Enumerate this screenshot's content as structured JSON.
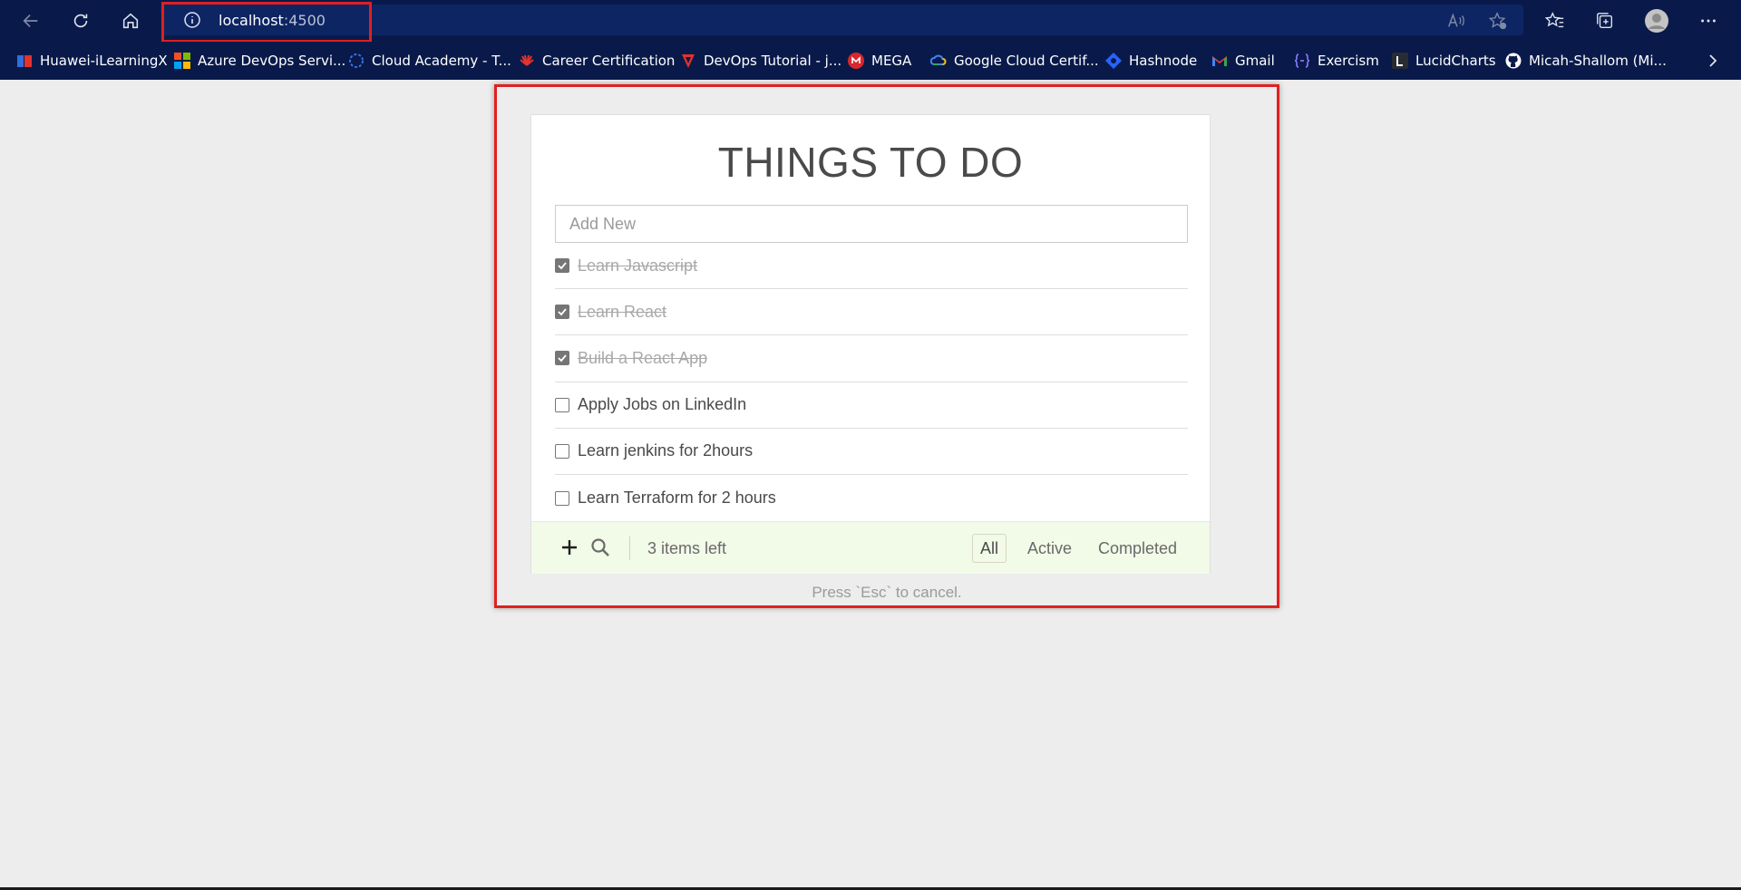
{
  "browser": {
    "url_host": "localhost",
    "url_port": ":4500"
  },
  "bookmarks": [
    {
      "label": "Huawei-iLearningX",
      "icon": "huawei-learning-icon",
      "color": "#e4322c"
    },
    {
      "label": "Azure DevOps Servi...",
      "icon": "microsoft-icon",
      "color": "#f25022"
    },
    {
      "label": "Cloud Academy - T...",
      "icon": "cloud-academy-icon",
      "color": "#3b6ee8"
    },
    {
      "label": "Career Certification",
      "icon": "huawei-icon",
      "color": "#e4322c"
    },
    {
      "label": "DevOps Tutorial - j...",
      "icon": "devops-tutorial-icon",
      "color": "#e4322c"
    },
    {
      "label": "MEGA",
      "icon": "mega-icon",
      "color": "#d9272e"
    },
    {
      "label": "Google Cloud Certif...",
      "icon": "google-cloud-icon",
      "color": "#4285f4"
    },
    {
      "label": "Hashnode",
      "icon": "hashnode-icon",
      "color": "#2962ff"
    },
    {
      "label": "Gmail",
      "icon": "gmail-icon",
      "color": "#ea4335"
    },
    {
      "label": "Exercism",
      "icon": "exercism-icon",
      "color": "#604fcd"
    },
    {
      "label": "LucidCharts",
      "icon": "lucidcharts-icon",
      "color": "#282c33"
    },
    {
      "label": "Micah-Shallom (Mi...",
      "icon": "github-icon",
      "color": "#ffffff"
    }
  ],
  "todo": {
    "title": "THINGS TO DO",
    "input_placeholder": "Add New",
    "items": [
      {
        "label": "Learn Javascript",
        "completed": true
      },
      {
        "label": "Learn React",
        "completed": true
      },
      {
        "label": "Build a React App",
        "completed": true
      },
      {
        "label": "Apply Jobs on LinkedIn",
        "completed": false
      },
      {
        "label": "Learn jenkins for 2hours",
        "completed": false
      },
      {
        "label": "Learn Terraform for 2 hours",
        "completed": false
      }
    ],
    "items_left": "3 items left",
    "filters": {
      "all": "All",
      "active": "Active",
      "completed": "Completed"
    },
    "selected_filter": "All",
    "hint": "Press `Esc` to cancel."
  },
  "colors": {
    "browser_bar": "#091a4a",
    "highlight": "#e02020",
    "footer_bg": "#f2fae8"
  }
}
